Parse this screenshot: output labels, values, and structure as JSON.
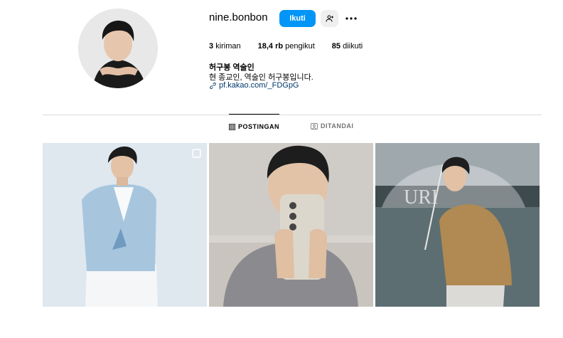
{
  "profile": {
    "username": "nine.bonbon",
    "follow_label": "Ikuti",
    "stats": {
      "posts_value": "3",
      "posts_label": "kiriman",
      "followers_value": "18,4 rb",
      "followers_label": "pengikut",
      "following_value": "85",
      "following_label": "diikuti"
    },
    "full_name": "허구봉 역술인",
    "bio": "현 종교인, 역술인 허구봉입니다.",
    "link_text": "pf.kakao.com/_FDGpG"
  },
  "tabs": [
    {
      "label": "POSTINGAN",
      "icon": "grid-icon",
      "active": true
    },
    {
      "label": "DITANDAI",
      "icon": "tagged-icon",
      "active": false
    }
  ],
  "posts": [
    {
      "description_icon": "carousel-icon"
    },
    {
      "description_icon": ""
    },
    {
      "description_icon": ""
    }
  ],
  "colors": {
    "accent": "#0095f6",
    "link": "#00376b",
    "muted": "#737373"
  }
}
